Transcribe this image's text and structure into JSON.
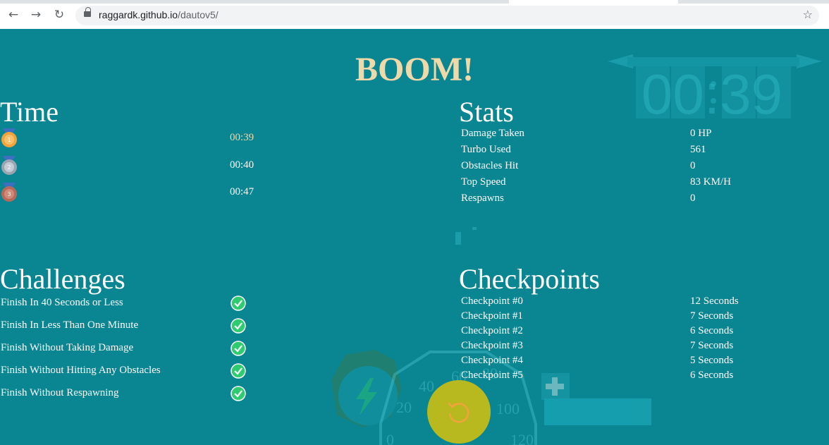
{
  "browser": {
    "url_host": "raggardk.github.io",
    "url_path": "/dautov5/"
  },
  "colors": {
    "background": "#0a8592",
    "title": "#f0d9a8",
    "check": "#2ecc71",
    "restart": "#b8b81f"
  },
  "boom_title": "BOOM!",
  "timer_display": {
    "minutes": "00",
    "seconds": "39"
  },
  "time": {
    "title": "Time",
    "entries": [
      {
        "rank": "1",
        "medal": "gold-medal-icon",
        "value": "00:39"
      },
      {
        "rank": "2",
        "medal": "silver-medal-icon",
        "value": "00:40"
      },
      {
        "rank": "3",
        "medal": "bronze-medal-icon",
        "value": "00:47"
      }
    ]
  },
  "stats": {
    "title": "Stats",
    "items": [
      {
        "label": "Damage Taken",
        "value": "0 HP"
      },
      {
        "label": "Turbo Used",
        "value": "561"
      },
      {
        "label": "Obstacles Hit",
        "value": "0"
      },
      {
        "label": "Top Speed",
        "value": "83 KM/H"
      },
      {
        "label": "Respawns",
        "value": "0"
      }
    ]
  },
  "challenges": {
    "title": "Challenges",
    "items": [
      {
        "label": "Finish In 40 Seconds or Less",
        "done": true
      },
      {
        "label": "Finish In Less Than One Minute",
        "done": true
      },
      {
        "label": "Finish Without Taking Damage",
        "done": true
      },
      {
        "label": "Finish Without Hitting Any Obstacles",
        "done": true
      },
      {
        "label": "Finish Without Respawning",
        "done": true
      }
    ]
  },
  "checkpoints": {
    "title": "Checkpoints",
    "items": [
      {
        "label": "Checkpoint #0",
        "value": "12 Seconds"
      },
      {
        "label": "Checkpoint #1",
        "value": "7 Seconds"
      },
      {
        "label": "Checkpoint #2",
        "value": "6 Seconds"
      },
      {
        "label": "Checkpoint #3",
        "value": "7 Seconds"
      },
      {
        "label": "Checkpoint #4",
        "value": "5 Seconds"
      },
      {
        "label": "Checkpoint #5",
        "value": "6 Seconds"
      }
    ]
  },
  "speedometer_ticks": [
    "0",
    "20",
    "40",
    "60",
    "80",
    "100",
    "120"
  ],
  "restart_icon": "restart-icon"
}
